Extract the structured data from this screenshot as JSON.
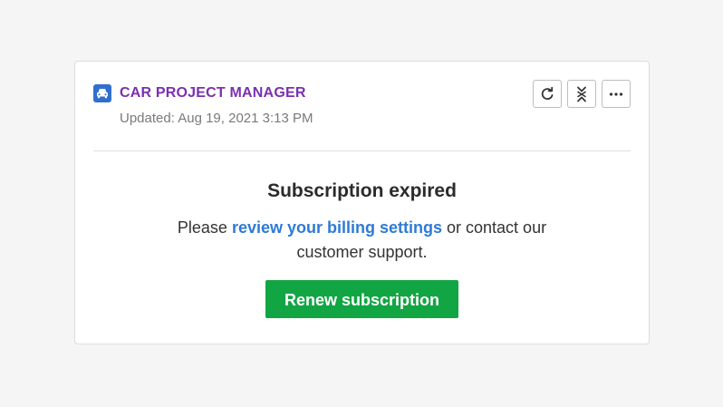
{
  "widget": {
    "app_icon": "car-icon",
    "app_title": "CAR PROJECT MANAGER",
    "updated_text": "Updated: Aug 19, 2021 3:13 PM",
    "actions": [
      {
        "icon": "refresh-icon"
      },
      {
        "icon": "collapse-icon"
      },
      {
        "icon": "more-icon"
      }
    ]
  },
  "content": {
    "heading": "Subscription expired",
    "message_prefix": "Please ",
    "message_link": "review your billing settings",
    "message_suffix": " or contact our customer support.",
    "button_label": "Renew subscription"
  },
  "colors": {
    "title": "#7b2fb0",
    "link": "#2f7ad6",
    "button": "#12a544",
    "icon_bg": "#2f6fce"
  }
}
